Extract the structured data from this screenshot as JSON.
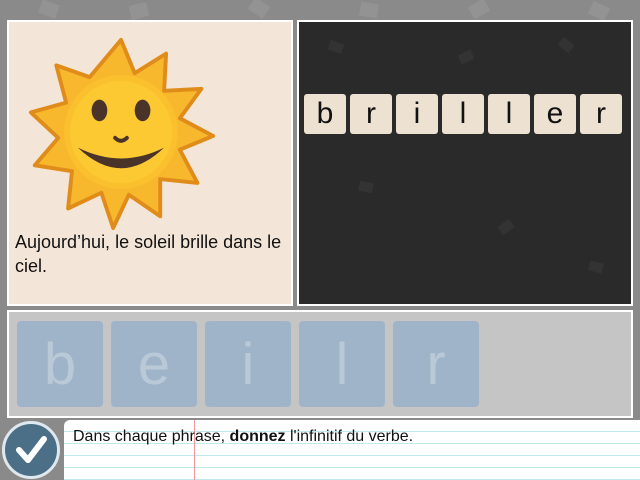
{
  "exercise": {
    "sentence": "Aujourd’hui, le soleil brille dans le ciel.",
    "illustration": "sun-face-icon",
    "answer_letters": [
      "b",
      "r",
      "i",
      "l",
      "l",
      "e",
      "r"
    ],
    "choice_letters": [
      "b",
      "e",
      "i",
      "l",
      "r"
    ]
  },
  "footer": {
    "instruction_before": "Dans chaque phrase, ",
    "instruction_bold": "donnez",
    "instruction_after": " l'infinitif du verbe.",
    "check_icon": "checkmark-icon"
  },
  "colors": {
    "board": "#2a2a2a",
    "picture_panel": "#f3e6d8",
    "answer_tile": "#ede1d2",
    "choice_tile": "#9fb4c9",
    "check_button": "#4b6f86"
  }
}
